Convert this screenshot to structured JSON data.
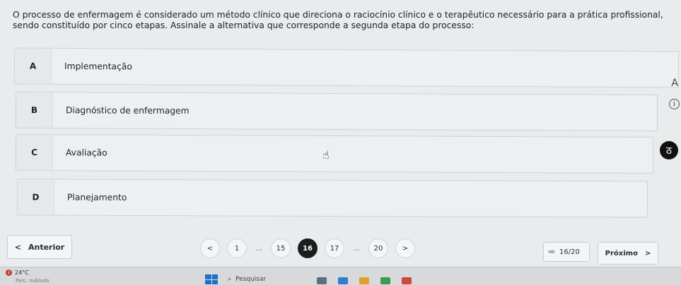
{
  "question": {
    "text": "O processo de enfermagem é considerado um método clínico que direciona o raciocínio clínico e o terapêutico necessário para a prática profissional, sendo constituído por cinco etapas. Assinale a alternativa que corresponde a segunda etapa do processo:"
  },
  "options": [
    {
      "letter": "A",
      "label": "Implementação"
    },
    {
      "letter": "B",
      "label": "Diagnóstico de enfermagem"
    },
    {
      "letter": "C",
      "label": "Avaliação"
    },
    {
      "letter": "D",
      "label": "Planejamento"
    }
  ],
  "side_tools": {
    "font_icon": "A",
    "info_icon": "i",
    "tool_icon": "ठ"
  },
  "navigation": {
    "prev_icon": "<",
    "prev_label": "Anterior",
    "pager_prev": "<",
    "pages": [
      "1",
      "...",
      "15",
      "16",
      "17",
      "...",
      "20"
    ],
    "pager_next": ">",
    "current_page": "16",
    "counter_icon": "≔",
    "counter_label": "16/20",
    "next_label": "Próximo",
    "next_icon": ">"
  },
  "taskbar": {
    "weather_badge": "2",
    "temperature": "24°C",
    "weather_text": "Parc. nublado",
    "search_label": "Pesquisar"
  },
  "colors": {
    "active_page": "#1b1d1f",
    "windows_blue": "#1a73c9",
    "background": "#e9ebec"
  }
}
